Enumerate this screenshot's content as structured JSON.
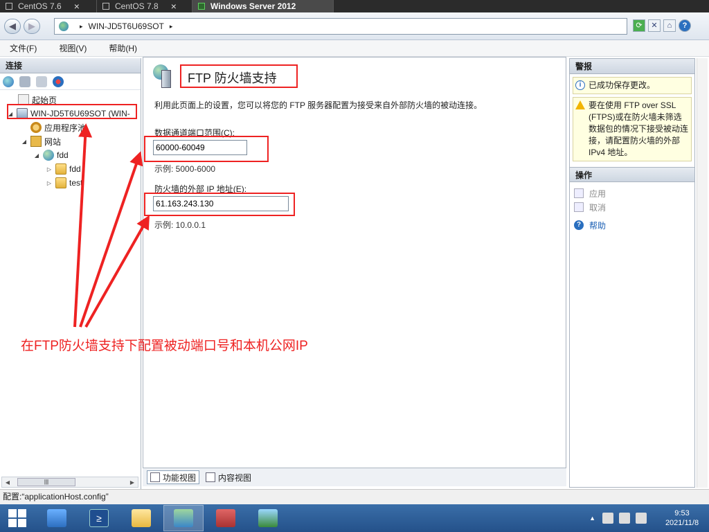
{
  "vm_tabs": [
    {
      "label": "CentOS 7.6",
      "active": false
    },
    {
      "label": "CentOS 7.8",
      "active": false
    },
    {
      "label": "Windows Server 2012",
      "active": true
    }
  ],
  "address": {
    "site_icon": "iis-server-icon",
    "path": "WIN-JD5T6U69SOT",
    "separator": "▸"
  },
  "menu": {
    "file": "文件(F)",
    "view": "视图(V)",
    "help": "帮助(H)"
  },
  "connections": {
    "title": "连接",
    "tree": {
      "start_page": "起始页",
      "server": "WIN-JD5T6U69SOT (WIN-",
      "app_pools": "应用程序池",
      "sites": "网站",
      "site": "fdd",
      "folder1": "fdd",
      "folder2": "test"
    }
  },
  "page": {
    "title": "FTP 防火墙支持",
    "description": "利用此页面上的设置，您可以将您的 FTP 服务器配置为接受来自外部防火墙的被动连接。",
    "port_range": {
      "label": "数据通道端口范围(C):",
      "value": "60000-60049",
      "example": "示例: 5000-6000"
    },
    "external_ip": {
      "label": "防火墙的外部 IP 地址(E):",
      "value": "61.163.243.130",
      "example": "示例: 10.0.0.1"
    }
  },
  "views": {
    "features": "功能视图",
    "content": "内容视图"
  },
  "alerts": {
    "title": "警报",
    "success": "已成功保存更改。",
    "warning": "要在使用 FTP over SSL (FTPS)或在防火墙未筛选数据包的情况下接受被动连接，请配置防火墙的外部 IPv4 地址。"
  },
  "actions": {
    "title": "操作",
    "apply": "应用",
    "cancel": "取消",
    "help": "帮助"
  },
  "status": {
    "config": "配置:“applicationHost.config”"
  },
  "taskbar": {
    "time": "9:53",
    "date": "2021/11/8"
  },
  "annotation": {
    "text": "在FTP防火墙支持下配置被动端口号和本机公网IP",
    "color": "#ee2222"
  }
}
